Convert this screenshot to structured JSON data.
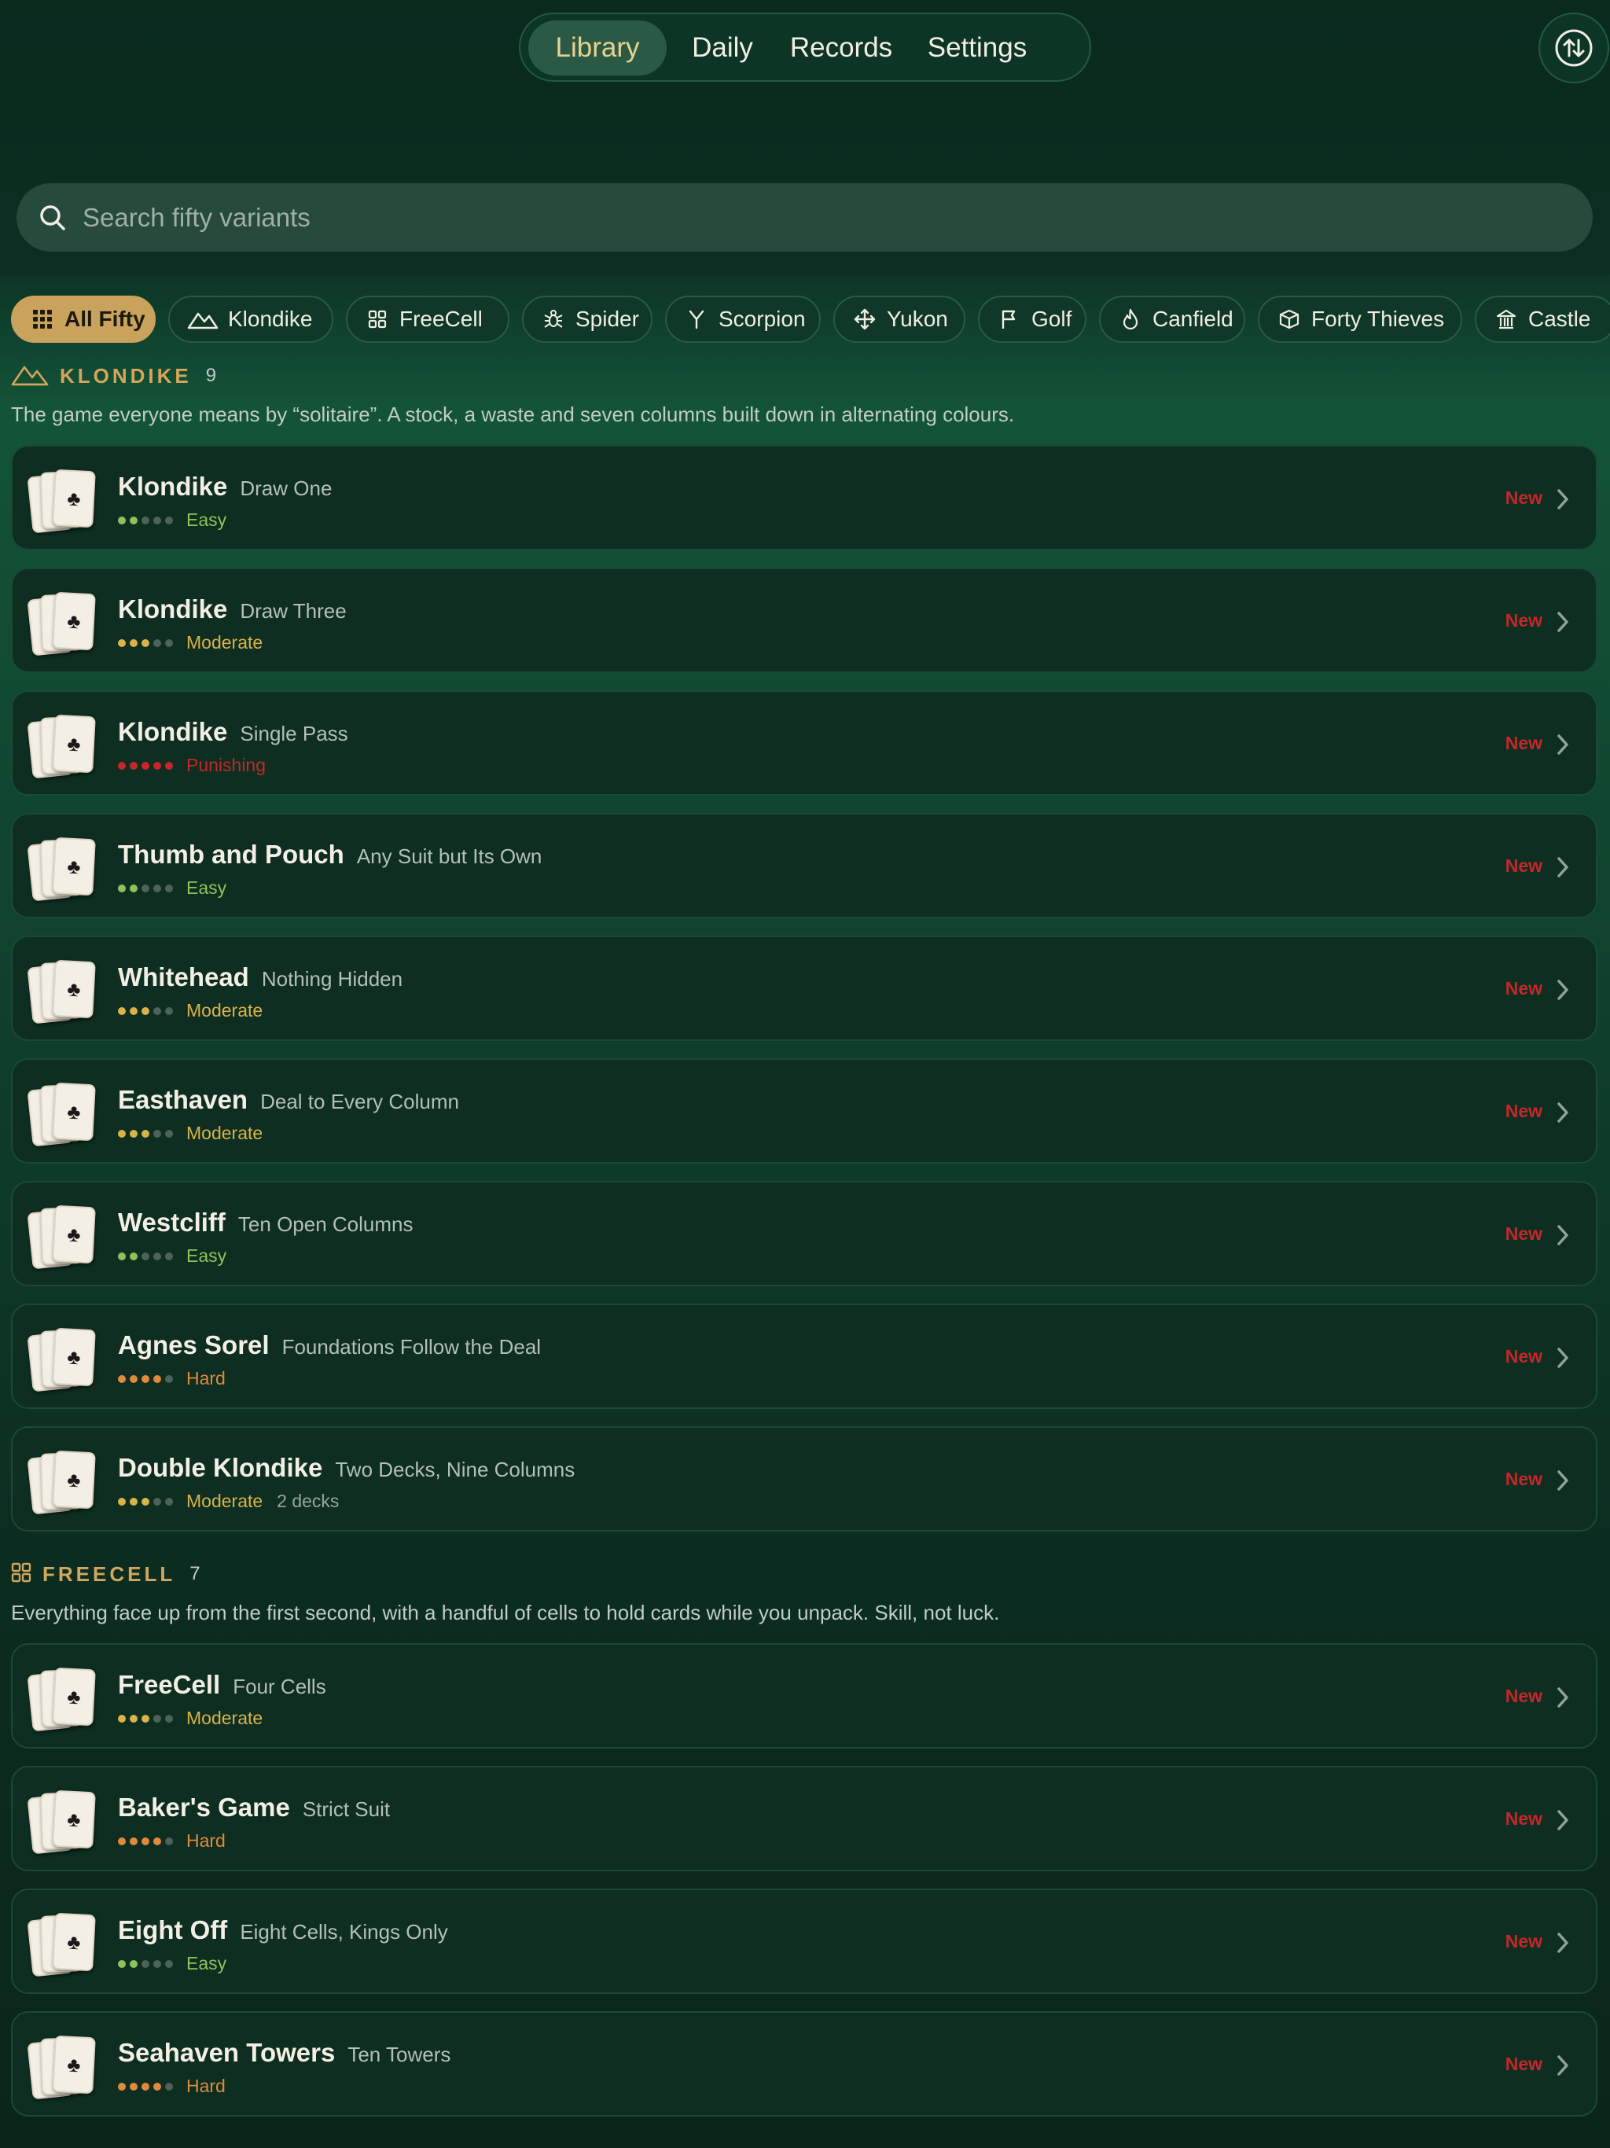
{
  "nav": {
    "tabs": [
      {
        "label": "Library",
        "active": true
      },
      {
        "label": "Daily",
        "active": false
      },
      {
        "label": "Records",
        "active": false
      },
      {
        "label": "Settings",
        "active": false
      }
    ],
    "sort_icon": "sort-arrows-icon"
  },
  "search": {
    "placeholder": "Search fifty variants",
    "value": ""
  },
  "filters": [
    {
      "label": "All Fifty",
      "icon": "grid-icon",
      "active": true
    },
    {
      "label": "Klondike",
      "icon": "mountains-icon"
    },
    {
      "label": "FreeCell",
      "icon": "four-squares-icon"
    },
    {
      "label": "Spider",
      "icon": "spider-icon"
    },
    {
      "label": "Scorpion",
      "icon": "fork-icon"
    },
    {
      "label": "Yukon",
      "icon": "move-icon"
    },
    {
      "label": "Golf",
      "icon": "flag-icon"
    },
    {
      "label": "Canfield",
      "icon": "flame-icon"
    },
    {
      "label": "Forty Thieves",
      "icon": "box-icon"
    },
    {
      "label": "Castle",
      "icon": "building-icon"
    }
  ],
  "difficulty_colors": {
    "Easy": "#8cc35a",
    "Moderate": "#d9b24a",
    "Hard": "#e08a3a",
    "Punishing": "#c7262b"
  },
  "new_color": "#c7262b",
  "sections": [
    {
      "title": "KLONDIKE",
      "icon": "mountains-icon",
      "count": "9",
      "description": "The game everyone means by “solitaire”. A stock, a waste and seven columns built down in alternating colours.",
      "games": [
        {
          "name": "Klondike",
          "subtitle": "Draw One",
          "level": 2,
          "difficulty": "Easy",
          "badge": "New"
        },
        {
          "name": "Klondike",
          "subtitle": "Draw Three",
          "level": 3,
          "difficulty": "Moderate",
          "badge": "New"
        },
        {
          "name": "Klondike",
          "subtitle": "Single Pass",
          "level": 5,
          "difficulty": "Punishing",
          "badge": "New"
        },
        {
          "name": "Thumb and Pouch",
          "subtitle": "Any Suit but Its Own",
          "level": 2,
          "difficulty": "Easy",
          "badge": "New"
        },
        {
          "name": "Whitehead",
          "subtitle": "Nothing Hidden",
          "level": 3,
          "difficulty": "Moderate",
          "badge": "New"
        },
        {
          "name": "Easthaven",
          "subtitle": "Deal to Every Column",
          "level": 3,
          "difficulty": "Moderate",
          "badge": "New"
        },
        {
          "name": "Westcliff",
          "subtitle": "Ten Open Columns",
          "level": 2,
          "difficulty": "Easy",
          "badge": "New"
        },
        {
          "name": "Agnes Sorel",
          "subtitle": "Foundations Follow the Deal",
          "level": 4,
          "difficulty": "Hard",
          "badge": "New"
        },
        {
          "name": "Double Klondike",
          "subtitle": "Two Decks, Nine Columns",
          "level": 3,
          "difficulty": "Moderate",
          "extra": "2 decks",
          "badge": "New"
        }
      ]
    },
    {
      "title": "FREECELL",
      "icon": "four-squares-icon",
      "count": "7",
      "description": "Everything face up from the first second, with a handful of cells to hold cards while you unpack. Skill, not luck.",
      "games": [
        {
          "name": "FreeCell",
          "subtitle": "Four Cells",
          "level": 3,
          "difficulty": "Moderate",
          "badge": "New"
        },
        {
          "name": "Baker's Game",
          "subtitle": "Strict Suit",
          "level": 4,
          "difficulty": "Hard",
          "badge": "New"
        },
        {
          "name": "Eight Off",
          "subtitle": "Eight Cells, Kings Only",
          "level": 2,
          "difficulty": "Easy",
          "badge": "New"
        },
        {
          "name": "Seahaven Towers",
          "subtitle": "Ten Towers",
          "level": 4,
          "difficulty": "Hard",
          "badge": "New"
        }
      ]
    }
  ],
  "card_suit": "♣"
}
